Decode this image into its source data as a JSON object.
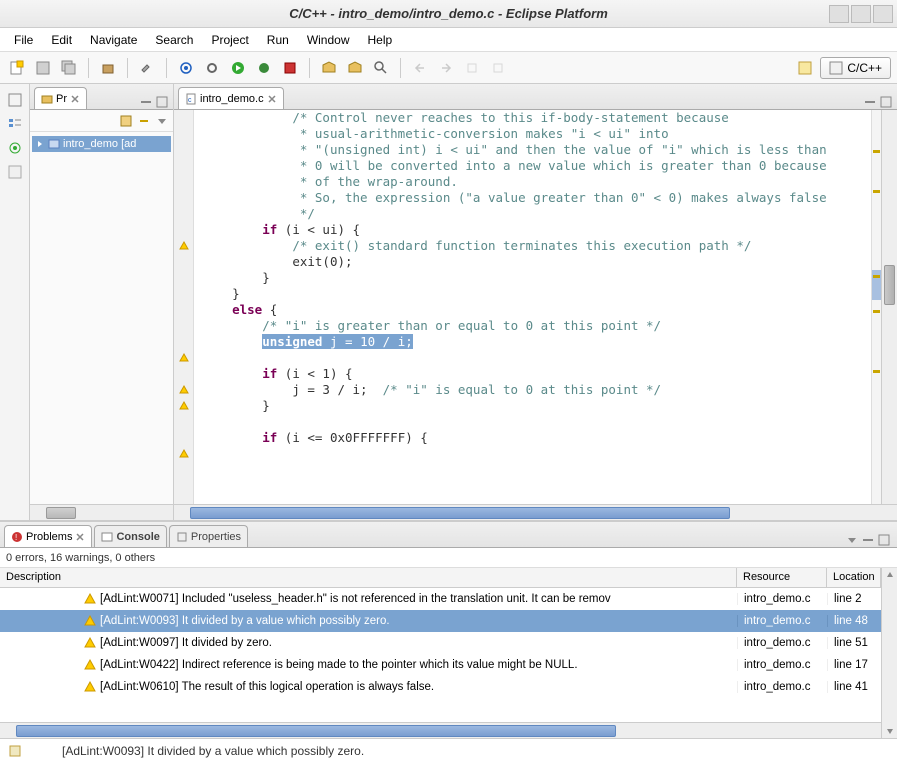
{
  "title": "C/C++ - intro_demo/intro_demo.c - Eclipse Platform",
  "menu": {
    "file": "File",
    "edit": "Edit",
    "navigate": "Navigate",
    "search": "Search",
    "project": "Project",
    "run": "Run",
    "window": "Window",
    "help": "Help"
  },
  "perspective": {
    "label": "C/C++"
  },
  "project_view": {
    "tab": "Pr",
    "item": "intro_demo [ad"
  },
  "editor": {
    "tab": "intro_demo.c"
  },
  "code": {
    "c1": "/* Control never reaches to this if-body-statement because",
    "c2": " * usual-arithmetic-conversion makes \"i < ui\" into",
    "c3": " * \"(unsigned int) i < ui\" and then the value of \"i\" which is less than",
    "c4": " * 0 will be converted into a new value which is greater than 0 because",
    "c5": " * of the wrap-around.",
    "c6": " * So, the expression (\"a value greater than 0\" < 0) makes always false",
    "c7": " */",
    "if1_kw": "if",
    "if1_cond": " (i < ui) {",
    "exitc": "/* exit() standard function terminates this execution path */",
    "exitcall": "exit(0);",
    "rb": "}",
    "else_kw": "else",
    "else_ob": " {",
    "ic": "/* \"i\" is greater than or equal to 0 at this point */",
    "sel_kw": "unsigned",
    "sel_rest": " j = 10 / i;",
    "if2_kw": "if",
    "if2_cond": " (i < 1) {",
    "j3": "j = 3 / i;  ",
    "j3c": "/* \"i\" is equal to 0 at this point */",
    "if3_kw": "if",
    "if3_cond": " (i <= 0x0FFFFFFF) {"
  },
  "problems": {
    "tab_problems": "Problems",
    "tab_console": "Console",
    "tab_properties": "Properties",
    "summary": "0 errors, 16 warnings, 0 others",
    "col_desc": "Description",
    "col_res": "Resource",
    "col_loc": "Location",
    "rows": [
      {
        "desc": "[AdLint:W0071] Included \"useless_header.h\" is not referenced in the translation unit. It can be remov",
        "res": "intro_demo.c",
        "loc": "line 2"
      },
      {
        "desc": "[AdLint:W0093] It divided by a value which possibly zero.",
        "res": "intro_demo.c",
        "loc": "line 48"
      },
      {
        "desc": "[AdLint:W0097] It divided by zero.",
        "res": "intro_demo.c",
        "loc": "line 51"
      },
      {
        "desc": "[AdLint:W0422] Indirect reference is being made to the pointer which its value might be NULL.",
        "res": "intro_demo.c",
        "loc": "line 17"
      },
      {
        "desc": "[AdLint:W0610] The result of this logical operation is always false.",
        "res": "intro_demo.c",
        "loc": "line 41"
      }
    ]
  },
  "status": {
    "msg": "[AdLint:W0093] It divided by a value which possibly zero."
  }
}
